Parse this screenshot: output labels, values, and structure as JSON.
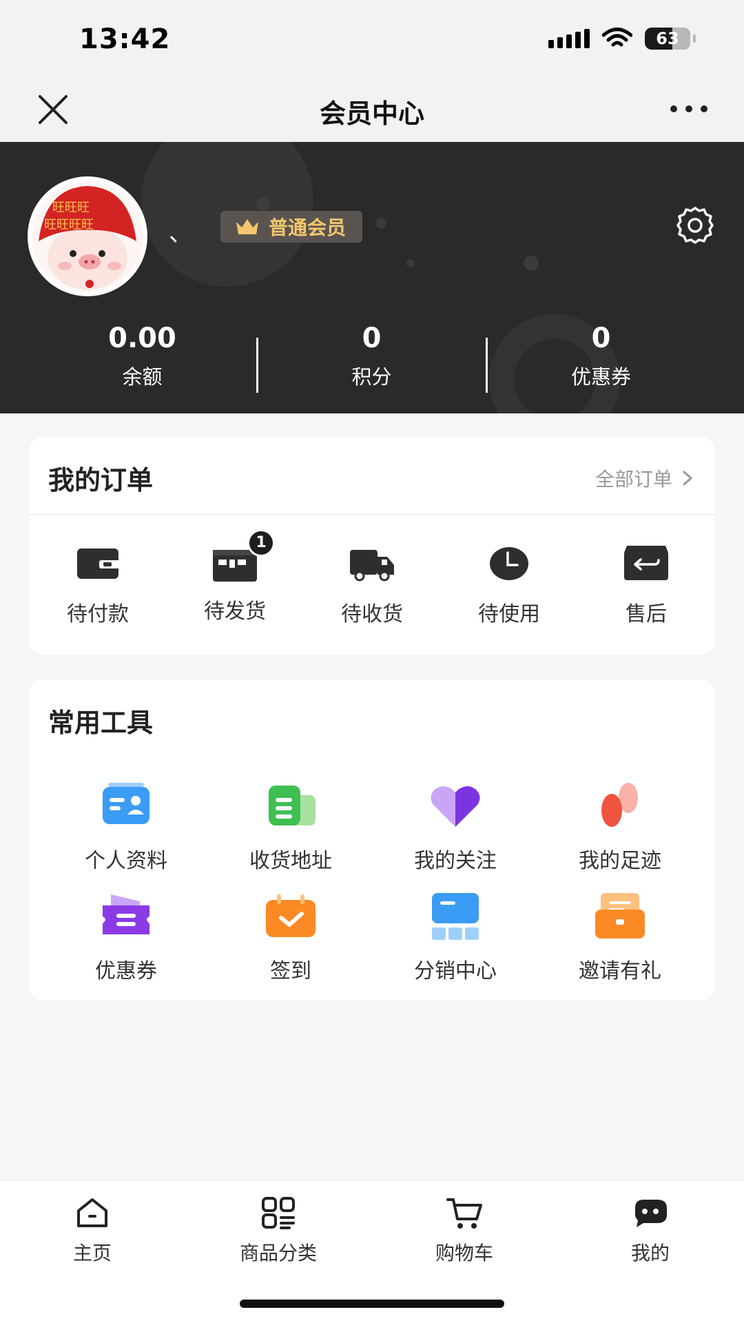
{
  "status": {
    "time": "13:42",
    "battery": "63"
  },
  "nav": {
    "title": "会员中心",
    "close_icon": "close-icon",
    "more_icon": "more-icon"
  },
  "profile": {
    "username": "、",
    "member_level": "普通会员",
    "settings_icon": "gear-icon"
  },
  "stats": [
    {
      "value": "0.00",
      "label": "余额"
    },
    {
      "value": "0",
      "label": "积分"
    },
    {
      "value": "0",
      "label": "优惠券"
    }
  ],
  "orders": {
    "title": "我的订单",
    "all_label": "全部订单",
    "items": [
      {
        "label": "待付款",
        "icon": "wallet-icon"
      },
      {
        "label": "待发货",
        "icon": "package-icon",
        "badge": "1"
      },
      {
        "label": "待收货",
        "icon": "truck-icon"
      },
      {
        "label": "待使用",
        "icon": "clock-icon"
      },
      {
        "label": "售后",
        "icon": "return-box-icon"
      }
    ]
  },
  "tools": {
    "title": "常用工具",
    "items": [
      {
        "label": "个人资料",
        "icon": "profile-card-icon"
      },
      {
        "label": "收货地址",
        "icon": "address-icon"
      },
      {
        "label": "我的关注",
        "icon": "heart-icon"
      },
      {
        "label": "我的足迹",
        "icon": "footprint-icon"
      },
      {
        "label": "优惠券",
        "icon": "coupon-icon"
      },
      {
        "label": "签到",
        "icon": "checkin-icon"
      },
      {
        "label": "分销中心",
        "icon": "distribution-icon"
      },
      {
        "label": "邀请有礼",
        "icon": "invite-gift-icon"
      }
    ]
  },
  "tabbar": [
    {
      "label": "主页",
      "icon": "home-icon"
    },
    {
      "label": "商品分类",
      "icon": "category-icon"
    },
    {
      "label": "购物车",
      "icon": "cart-icon"
    },
    {
      "label": "我的",
      "icon": "chat-bubble-icon"
    }
  ],
  "colors": {
    "header_bg": "#2a2a2b",
    "badge_gold": "#f2c76e",
    "page_bg": "#f6f6f6"
  }
}
